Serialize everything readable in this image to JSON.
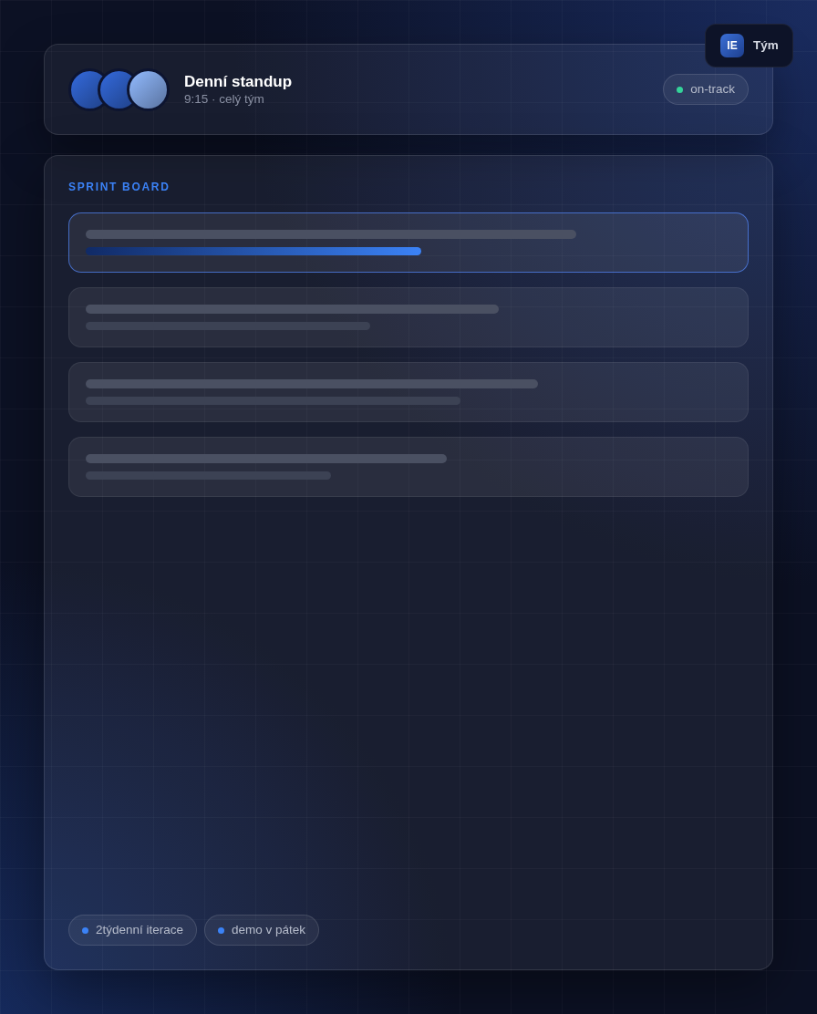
{
  "team_badge": {
    "initials": "IE",
    "label": "Tým"
  },
  "header": {
    "avatars": [
      {
        "color": "#2d5cc0"
      },
      {
        "color": "#2d5cc0"
      },
      {
        "color": "#7fa3e3"
      }
    ],
    "title": "Denní standup",
    "subtitle": "9:15 · celý tým",
    "status": {
      "label": "on-track"
    }
  },
  "board": {
    "title": "SPRINT BOARD",
    "cards": [
      {
        "selected": true
      },
      {
        "selected": false
      },
      {
        "selected": false
      },
      {
        "selected": false
      }
    ]
  },
  "chips": [
    {
      "label": "2týdenní iterace"
    },
    {
      "label": "demo v pátek"
    }
  ]
}
